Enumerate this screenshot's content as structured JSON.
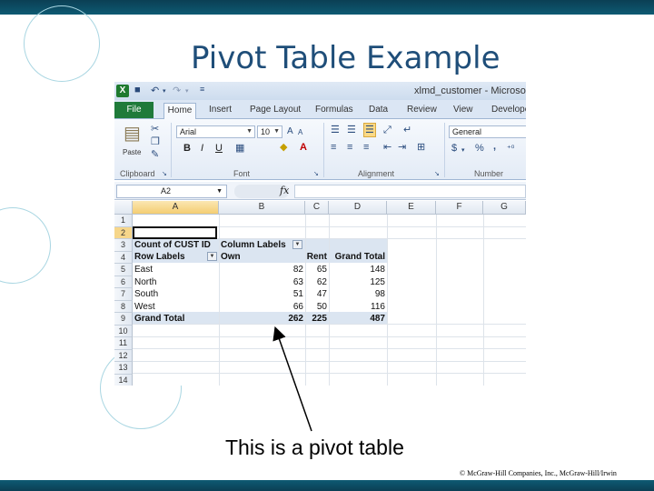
{
  "slide": {
    "title": "Pivot Table Example",
    "caption": "This is a pivot table",
    "copyright": "© McGraw-Hill Companies, Inc., McGraw-Hill/Irwin"
  },
  "colors": {
    "top_bar": "#0b3f54",
    "title": "#1f4e79",
    "file_tab": "#1f7a3a",
    "pivot_band": "#dbe5f1"
  },
  "excel": {
    "window_title": "xlmd_customer - Microsof",
    "quick_access": {
      "app_icon": "X"
    },
    "tabs": [
      "File",
      "Home",
      "Insert",
      "Page Layout",
      "Formulas",
      "Data",
      "Review",
      "View",
      "Develope"
    ],
    "ribbon": {
      "paste_label": "Paste",
      "font_name": "Arial",
      "font_size": "10",
      "number_format": "General",
      "bold": "B",
      "italic": "I",
      "underline": "U",
      "percent": "%",
      "comma": ",",
      "currency": "$",
      "groups": {
        "clipboard": "Clipboard",
        "font": "Font",
        "alignment": "Alignment",
        "number": "Number"
      }
    },
    "formula_bar": {
      "name_box": "A2",
      "fx": "fx",
      "content": ""
    },
    "columns": [
      "A",
      "B",
      "C",
      "D",
      "E",
      "F",
      "G"
    ],
    "rows": [
      "1",
      "2",
      "3",
      "4",
      "5",
      "6",
      "7",
      "8",
      "9",
      "10",
      "11",
      "12",
      "13",
      "14"
    ],
    "pivot": {
      "count_label": "Count of CUST ID",
      "column_labels": "Column Labels",
      "row_labels": "Row Labels",
      "col_own": "Own",
      "col_rent": "Rent",
      "col_total": "Grand Total",
      "data": [
        {
          "region": "East",
          "own": "82",
          "rent": "65",
          "total": "148"
        },
        {
          "region": "North",
          "own": "63",
          "rent": "62",
          "total": "125"
        },
        {
          "region": "South",
          "own": "51",
          "rent": "47",
          "total": "98"
        },
        {
          "region": "West",
          "own": "66",
          "rent": "50",
          "total": "116"
        }
      ],
      "grand": {
        "label": "Grand Total",
        "own": "262",
        "rent": "225",
        "total": "487"
      }
    }
  }
}
